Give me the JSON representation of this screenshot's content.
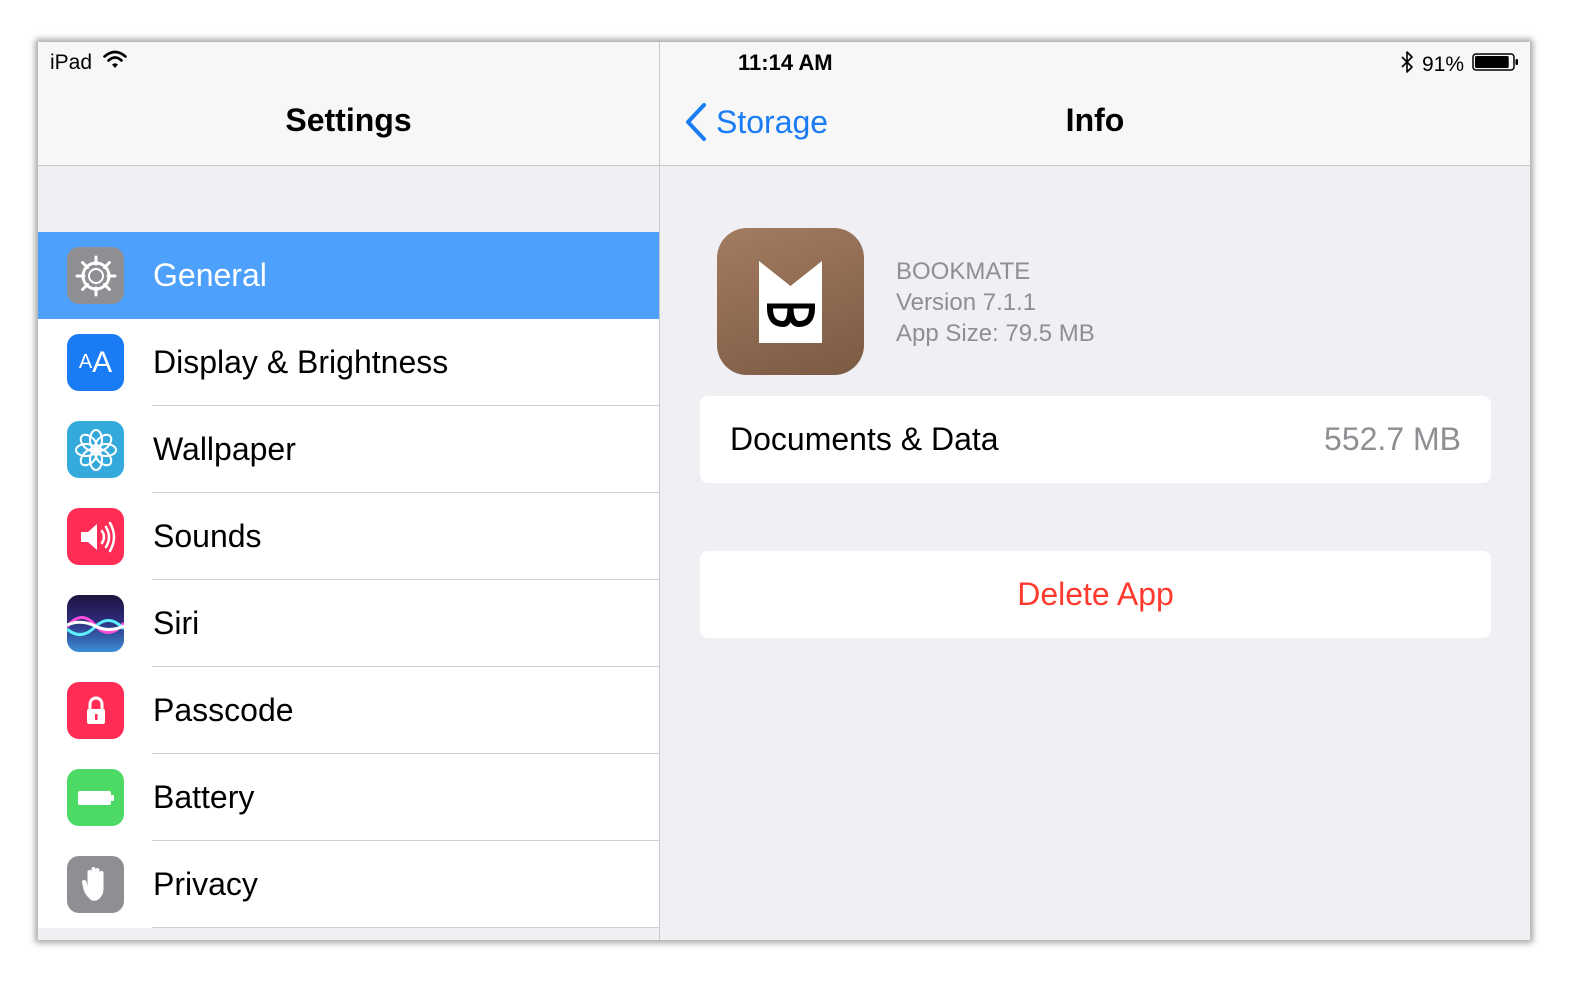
{
  "status_bar": {
    "device": "iPad",
    "time": "11:14 AM",
    "battery_percent": "91%",
    "battery_level": 0.91,
    "icons": [
      "wifi-icon",
      "bluetooth-icon",
      "battery-icon"
    ]
  },
  "master": {
    "title": "Settings",
    "items": [
      {
        "label": "General",
        "icon": "gear-icon",
        "color": "#8e8e93",
        "selected": true
      },
      {
        "label": "Display & Brightness",
        "icon": "text-size-icon",
        "color": "#1a7cf5"
      },
      {
        "label": "Wallpaper",
        "icon": "flower-icon",
        "color": "#34aadc"
      },
      {
        "label": "Sounds",
        "icon": "speaker-icon",
        "color": "#ff2d55"
      },
      {
        "label": "Siri",
        "icon": "siri-icon",
        "color": "#2b1f5c"
      },
      {
        "label": "Passcode",
        "icon": "lock-icon",
        "color": "#ff2d55"
      },
      {
        "label": "Battery",
        "icon": "battery-icon",
        "color": "#4cd964"
      },
      {
        "label": "Privacy",
        "icon": "hand-icon",
        "color": "#8e8e93"
      }
    ]
  },
  "detail": {
    "back_label": "Storage",
    "title": "Info",
    "app": {
      "name": "BOOKMATE",
      "version": "Version 7.1.1",
      "size": "App Size: 79.5 MB"
    },
    "documents": {
      "label": "Documents & Data",
      "value": "552.7 MB"
    },
    "delete_label": "Delete App"
  },
  "colors": {
    "accent": "#1a7cf5",
    "selected_row": "#4da0fb",
    "destructive": "#ff3b30"
  }
}
